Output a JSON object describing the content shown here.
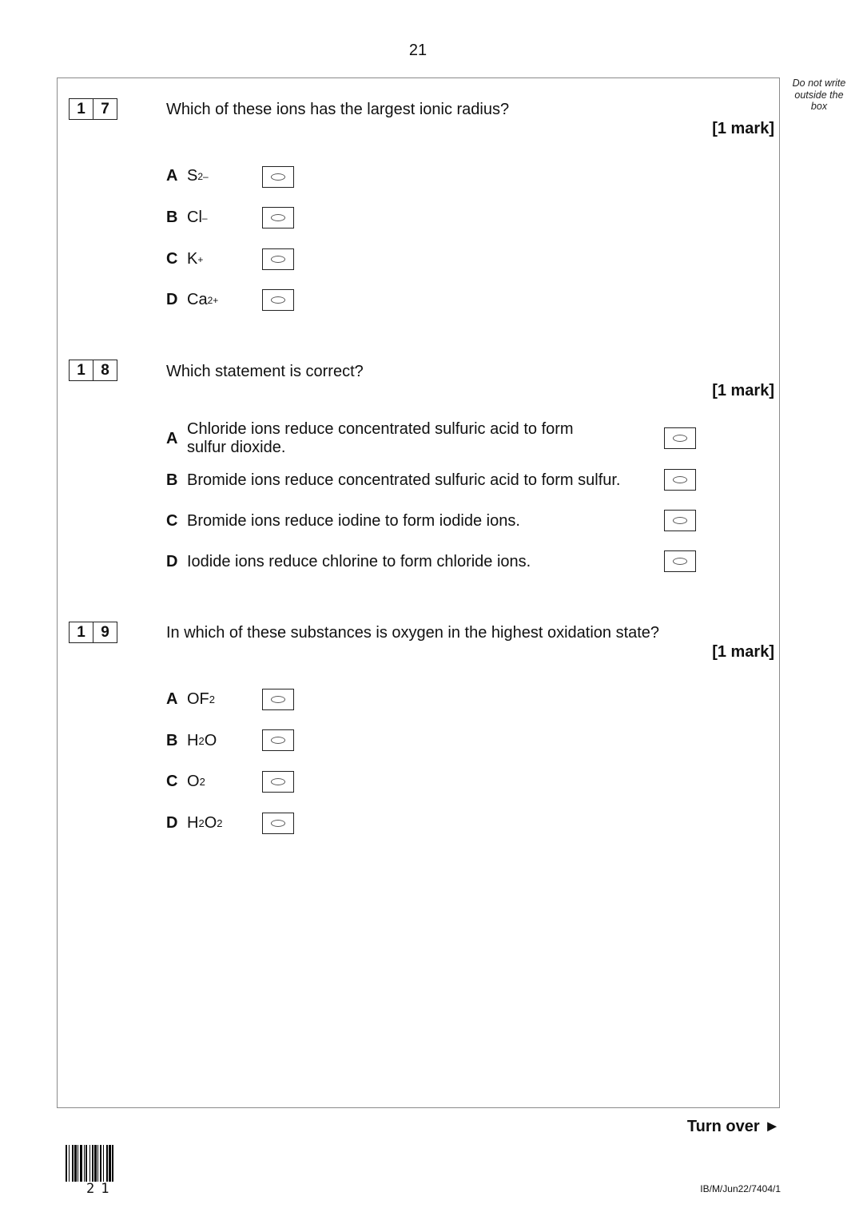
{
  "page_number": "21",
  "margin_note": "Do not write outside the box",
  "questions": [
    {
      "num": [
        "1",
        "7"
      ],
      "text": "Which of these ions has the largest ionic radius?",
      "mark": "[1 mark]",
      "options": [
        {
          "letter": "A",
          "base": "S",
          "sup": "2–",
          "sub": ""
        },
        {
          "letter": "B",
          "base": "Cl",
          "sup": "–",
          "sub": ""
        },
        {
          "letter": "C",
          "base": "K",
          "sup": "+",
          "sub": ""
        },
        {
          "letter": "D",
          "base": "Ca",
          "sup": "2+",
          "sub": ""
        }
      ]
    },
    {
      "num": [
        "1",
        "8"
      ],
      "text": "Which statement is correct?",
      "mark": "[1 mark]",
      "options": [
        {
          "letter": "A",
          "line1": "Chloride ions reduce concentrated sulfuric acid to form",
          "line2": "sulfur dioxide."
        },
        {
          "letter": "B",
          "text": "Bromide ions reduce concentrated sulfuric acid to form sulfur."
        },
        {
          "letter": "C",
          "text": "Bromide ions reduce iodine to form iodide ions."
        },
        {
          "letter": "D",
          "text": "Iodide ions reduce chlorine to form chloride ions."
        }
      ]
    },
    {
      "num": [
        "1",
        "9"
      ],
      "text": "In which of these substances is oxygen in the highest oxidation state?",
      "mark": "[1 mark]",
      "options": [
        {
          "letter": "A",
          "p1": "OF",
          "s1": "2",
          "p2": "",
          "s2": ""
        },
        {
          "letter": "B",
          "p1": "H",
          "s1": "2",
          "p2": "O",
          "s2": ""
        },
        {
          "letter": "C",
          "p1": "O",
          "s1": "2",
          "p2": "",
          "s2": ""
        },
        {
          "letter": "D",
          "p1": "H",
          "s1": "2",
          "p2": "O",
          "s2": "2"
        }
      ]
    }
  ],
  "footer": {
    "turn_over": "Turn over ►",
    "code": "IB/M/Jun22/7404/1",
    "barcode_number": "21"
  }
}
